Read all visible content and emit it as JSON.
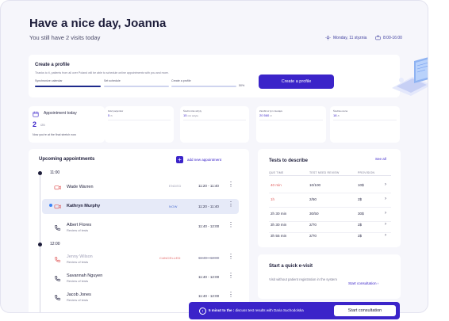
{
  "header": {
    "greeting": "Have a nice day, Joanna",
    "subtitle": "You still have 2 visits today",
    "date": "Monday, 11 styznia",
    "time": "8:00-16:00"
  },
  "profile": {
    "title": "Create a profile",
    "description": "Thanks to it, patients from all over Poland will be able to schedule online appointments with you and more.",
    "steps": [
      {
        "label": "Synchronize calendar",
        "progress": 1.0
      },
      {
        "label": "Set schedule",
        "progress": 0.0
      },
      {
        "label": "Create a profile",
        "progress": 0.0
      }
    ],
    "percent": "50%",
    "button_label": "Create a profile"
  },
  "appointment_today": {
    "label": "Appointment today",
    "count": "2",
    "total": "/25",
    "note": "Now you're at the final stretch now"
  },
  "stats": [
    {
      "label": "Ilość pacjentów",
      "value": "5",
      "unit": "/h"
    },
    {
      "label": "Średni czas wizyty",
      "value": "15",
      "unit": "min wizyta"
    },
    {
      "label": "Zarobki w tym miesiącu",
      "value": "20 560",
      "unit": "zł"
    },
    {
      "label": "Średnia ocena",
      "value": "18",
      "unit": "/h"
    }
  ],
  "appointments": {
    "title": "Upcoming appointments",
    "add_label": "add new appointment",
    "groups": [
      {
        "time": "11:00",
        "items": [
          {
            "name": "Wade Warren",
            "sub": "",
            "status": "ENDED",
            "time": "11:20 - 11:40",
            "type": "video"
          },
          {
            "name": "Kathryn Murphy",
            "sub": "",
            "status": "NOW",
            "time": "11:20 - 11:40",
            "type": "video"
          },
          {
            "name": "Albert Flores",
            "sub": "Review of tests",
            "status": "",
            "time": "11:40 - 12:00",
            "type": "phone"
          }
        ]
      },
      {
        "time": "12:00",
        "items": [
          {
            "name": "Jenny Wilson",
            "sub": "Review of tests",
            "status": "CANCELLED",
            "time": "11:40 - 12:00",
            "type": "phone"
          },
          {
            "name": "Savannah Nguyen",
            "sub": "Review of tests",
            "status": "",
            "time": "11:40 - 12:00",
            "type": "phone"
          },
          {
            "name": "Jacob Jones",
            "sub": "Review of tests",
            "status": "",
            "time": "11:40 - 12:00",
            "type": "phone"
          }
        ]
      }
    ]
  },
  "tests": {
    "title": "Tests to describe",
    "see_all": "See all",
    "columns": [
      "QUE TIME",
      "TEST NEED REVIEW",
      "PROVISION"
    ],
    "rows": [
      {
        "time": "40 min",
        "need": "10/100",
        "provision": "10$",
        "urgent": true
      },
      {
        "time": "1h",
        "need": "2/50",
        "provision": "2$",
        "urgent": true
      },
      {
        "time": "2h 30 min",
        "need": "30/50",
        "provision": "30$",
        "urgent": false
      },
      {
        "time": "3h 30 min",
        "need": "2/70",
        "provision": "2$",
        "urgent": false
      },
      {
        "time": "3h 55 min",
        "need": "2/70",
        "provision": "2$",
        "urgent": false
      }
    ]
  },
  "evisit": {
    "title": "Start a quick e-visit",
    "description": "Visit without patient registration in the system",
    "link": "Start consultation"
  },
  "banner": {
    "lead": "5 minut to the :",
    "message": "discuss test results with Daria Suchodolska",
    "button": "Start consultation"
  },
  "colors": {
    "primary": "#3b24c9",
    "danger": "#e05a5a",
    "now": "#4a6fd1"
  }
}
